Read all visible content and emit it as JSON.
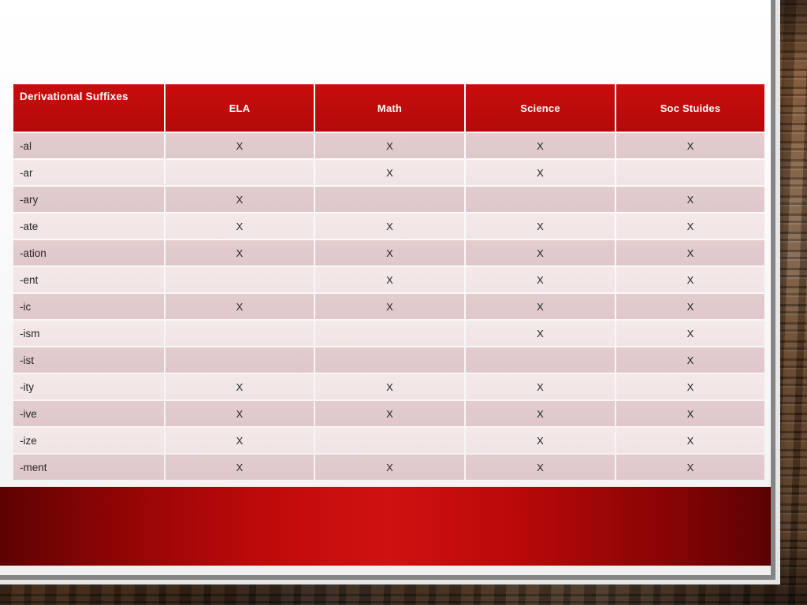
{
  "slide": {
    "title_row_label": "Derivational Suffixes"
  },
  "table": {
    "columns": [
      "Derivational Suffixes",
      "ELA",
      "Math",
      "Science",
      "Soc Stuides"
    ],
    "mark": "X",
    "blank": "",
    "rows": [
      {
        "suffix": "-al",
        "ela": "X",
        "math": "X",
        "science": "X",
        "soc": "X"
      },
      {
        "suffix": "-ar",
        "ela": "",
        "math": "X",
        "science": "X",
        "soc": ""
      },
      {
        "suffix": "-ary",
        "ela": "X",
        "math": "",
        "science": "",
        "soc": "X"
      },
      {
        "suffix": "-ate",
        "ela": "X",
        "math": "X",
        "science": "X",
        "soc": "X"
      },
      {
        "suffix": "-ation",
        "ela": "X",
        "math": "X",
        "science": "X",
        "soc": "X"
      },
      {
        "suffix": "-ent",
        "ela": "",
        "math": "X",
        "science": "X",
        "soc": "X"
      },
      {
        "suffix": "-ic",
        "ela": "X",
        "math": "X",
        "science": "X",
        "soc": "X"
      },
      {
        "suffix": "-ism",
        "ela": "",
        "math": "",
        "science": "X",
        "soc": "X"
      },
      {
        "suffix": "-ist",
        "ela": "",
        "math": "",
        "science": "",
        "soc": "X"
      },
      {
        "suffix": "-ity",
        "ela": "X",
        "math": "X",
        "science": "X",
        "soc": "X"
      },
      {
        "suffix": "-ive",
        "ela": "X",
        "math": "X",
        "science": "X",
        "soc": "X"
      },
      {
        "suffix": "-ize",
        "ela": "X",
        "math": "",
        "science": "X",
        "soc": "X"
      },
      {
        "suffix": "-ment",
        "ela": "X",
        "math": "X",
        "science": "X",
        "soc": "X"
      }
    ]
  },
  "colors": {
    "header_red": "#bd0b0b",
    "band_red": "#cf1111",
    "band_red_dark": "#5d0202",
    "row_odd": "#e1c9cb",
    "row_even": "#f3e6e6",
    "slide_bg": "#fafafa",
    "frame_gray": "#858585"
  }
}
